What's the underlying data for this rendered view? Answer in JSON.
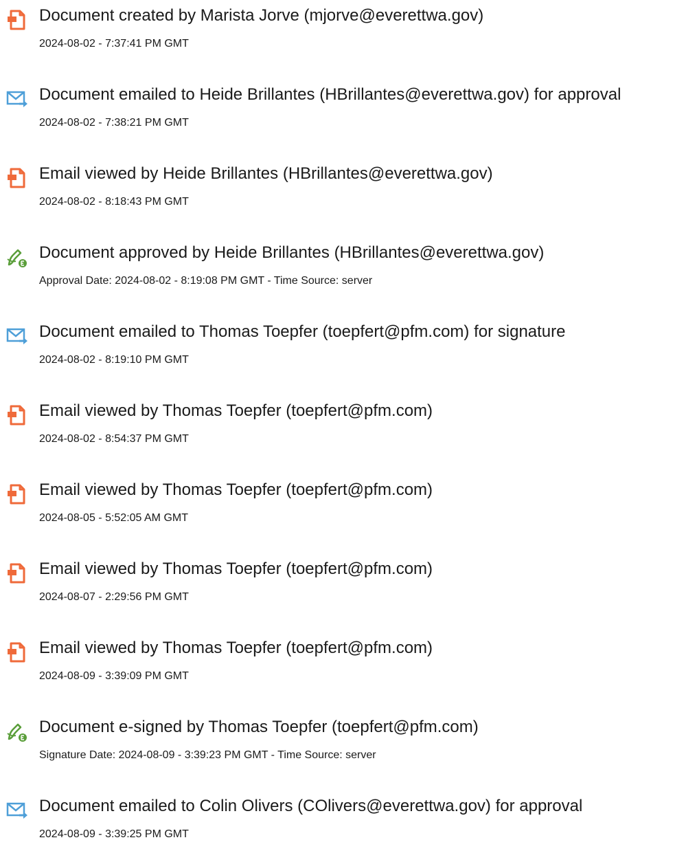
{
  "colors": {
    "doc_icon": "#ef6a3a",
    "email_icon": "#4e9fd8",
    "sign_icon": "#5a9e3a",
    "text": "#1a1a1a"
  },
  "events": [
    {
      "icon": "document-icon",
      "title": "Document created by Marista Jorve (mjorve@everettwa.gov)",
      "detail": "2024-08-02 - 7:37:41 PM GMT"
    },
    {
      "icon": "email-sent-icon",
      "title": "Document emailed to Heide Brillantes (HBrillantes@everettwa.gov) for approval",
      "detail": "2024-08-02 - 7:38:21 PM GMT"
    },
    {
      "icon": "document-icon",
      "title": "Email viewed by Heide Brillantes (HBrillantes@everettwa.gov)",
      "detail": "2024-08-02 - 8:18:43 PM GMT"
    },
    {
      "icon": "signature-pen-icon",
      "title": "Document approved by Heide Brillantes (HBrillantes@everettwa.gov)",
      "detail": "Approval Date: 2024-08-02 - 8:19:08 PM GMT - Time Source: server"
    },
    {
      "icon": "email-sent-icon",
      "title": "Document emailed to Thomas Toepfer (toepfert@pfm.com) for signature",
      "detail": "2024-08-02 - 8:19:10 PM GMT"
    },
    {
      "icon": "document-icon",
      "title": "Email viewed by Thomas Toepfer (toepfert@pfm.com)",
      "detail": "2024-08-02 - 8:54:37 PM GMT"
    },
    {
      "icon": "document-icon",
      "title": "Email viewed by Thomas Toepfer (toepfert@pfm.com)",
      "detail": "2024-08-05 - 5:52:05 AM GMT"
    },
    {
      "icon": "document-icon",
      "title": "Email viewed by Thomas Toepfer (toepfert@pfm.com)",
      "detail": "2024-08-07 - 2:29:56 PM GMT"
    },
    {
      "icon": "document-icon",
      "title": "Email viewed by Thomas Toepfer (toepfert@pfm.com)",
      "detail": "2024-08-09 - 3:39:09 PM GMT"
    },
    {
      "icon": "signature-pen-icon",
      "title": "Document e-signed by Thomas Toepfer (toepfert@pfm.com)",
      "detail": "Signature Date: 2024-08-09 - 3:39:23 PM GMT - Time Source: server"
    },
    {
      "icon": "email-sent-icon",
      "title": "Document emailed to Colin Olivers (COlivers@everettwa.gov) for approval",
      "detail": "2024-08-09 - 3:39:25 PM GMT"
    }
  ]
}
